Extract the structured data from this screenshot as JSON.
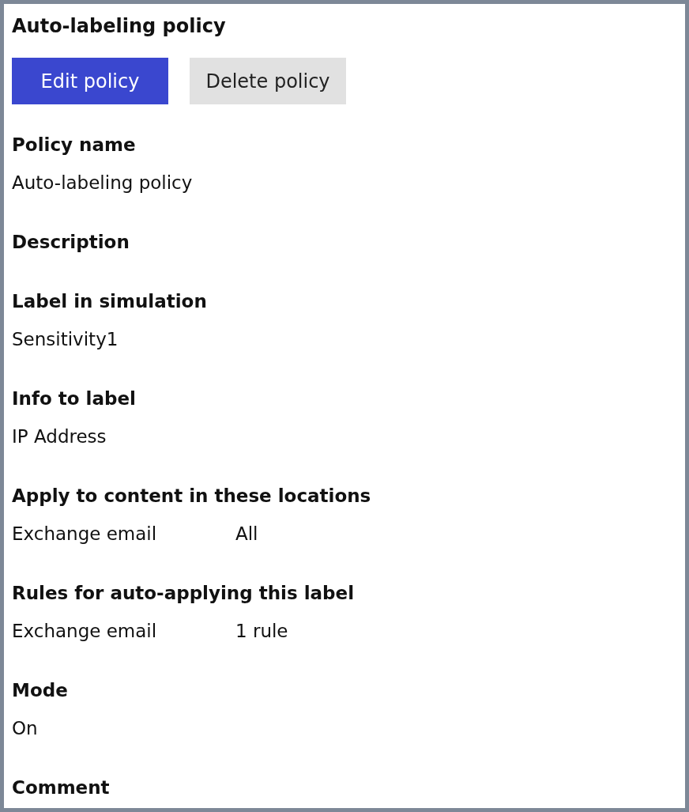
{
  "title": "Auto-labeling policy",
  "buttons": [
    {
      "label": "Edit policy",
      "kind": "primary"
    },
    {
      "label": "Delete policy",
      "kind": "secondary"
    }
  ],
  "fields": [
    {
      "label": "Policy name",
      "value": "Auto-labeling policy"
    },
    {
      "label": "Description"
    },
    {
      "label": "Label in simulation",
      "value": "Sensitivity1"
    },
    {
      "label": "Info to label",
      "value": "IP Address"
    },
    {
      "label": "Apply to content in these locations",
      "rows": [
        {
          "location": "Exchange email",
          "setting": "All"
        }
      ]
    },
    {
      "label": "Rules for auto-applying this label",
      "rows": [
        {
          "location": "Exchange email",
          "setting": "1 rule"
        }
      ]
    },
    {
      "label": "Mode",
      "value": "On"
    },
    {
      "label": "Comment"
    }
  ]
}
